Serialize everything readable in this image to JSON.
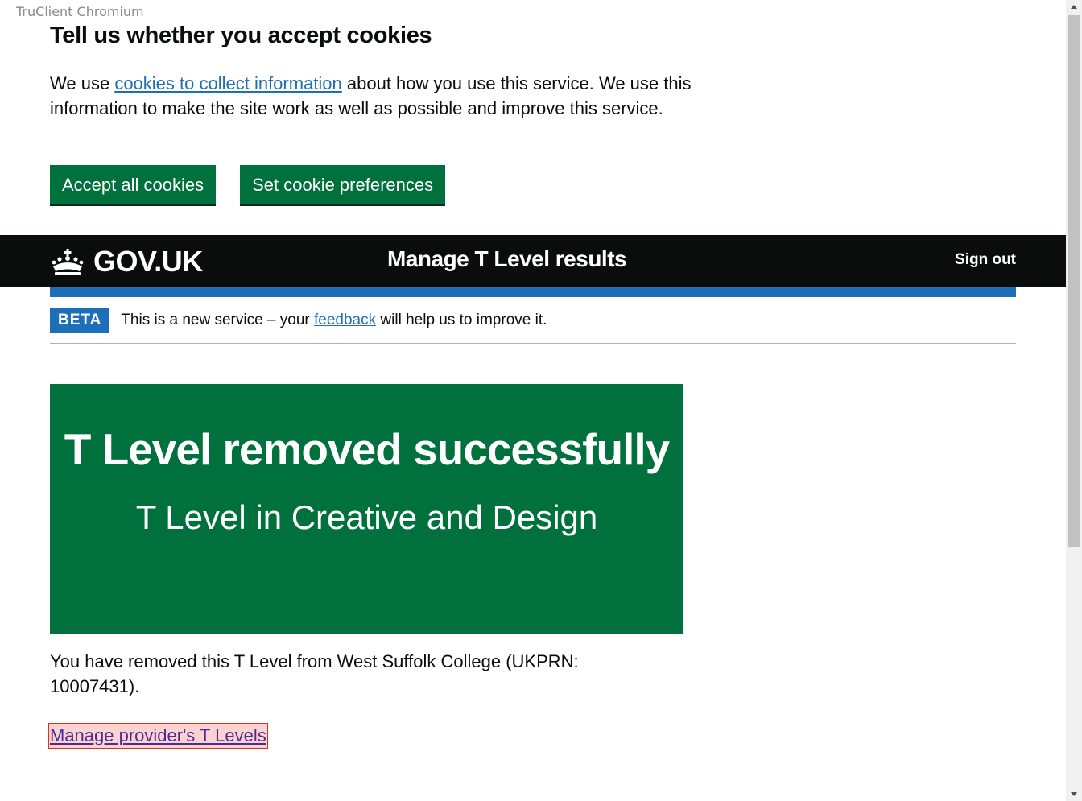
{
  "browser": {
    "label": "TruClient Chromium"
  },
  "cookie_banner": {
    "heading": "Tell us whether you accept cookies",
    "text_before": "We use ",
    "link": "cookies to collect information",
    "text_after": " about how you use this service. We use this information to make the site work as well as possible and improve this service.",
    "accept_button": "Accept all cookies",
    "preferences_button": "Set cookie preferences"
  },
  "header": {
    "logo_text": "GOV.UK",
    "logo_icon": "crown-icon",
    "service_name": "Manage T Level results",
    "sign_out": "Sign out"
  },
  "phase_banner": {
    "tag": "BETA",
    "text_before": "This is a new service – your ",
    "link": "feedback",
    "text_after": " will help us to improve it."
  },
  "panel": {
    "title": "T Level removed successfully",
    "body": "T Level in Creative and Design"
  },
  "main": {
    "body_text": "You have removed this T Level from West Suffolk College (UKPRN: 10007431).",
    "link": "Manage provider's T Levels"
  },
  "colors": {
    "govuk_green": "#00703c",
    "govuk_blue": "#1d70b8",
    "header_black": "#0b0c0c",
    "visited_link": "#4c2c92"
  }
}
